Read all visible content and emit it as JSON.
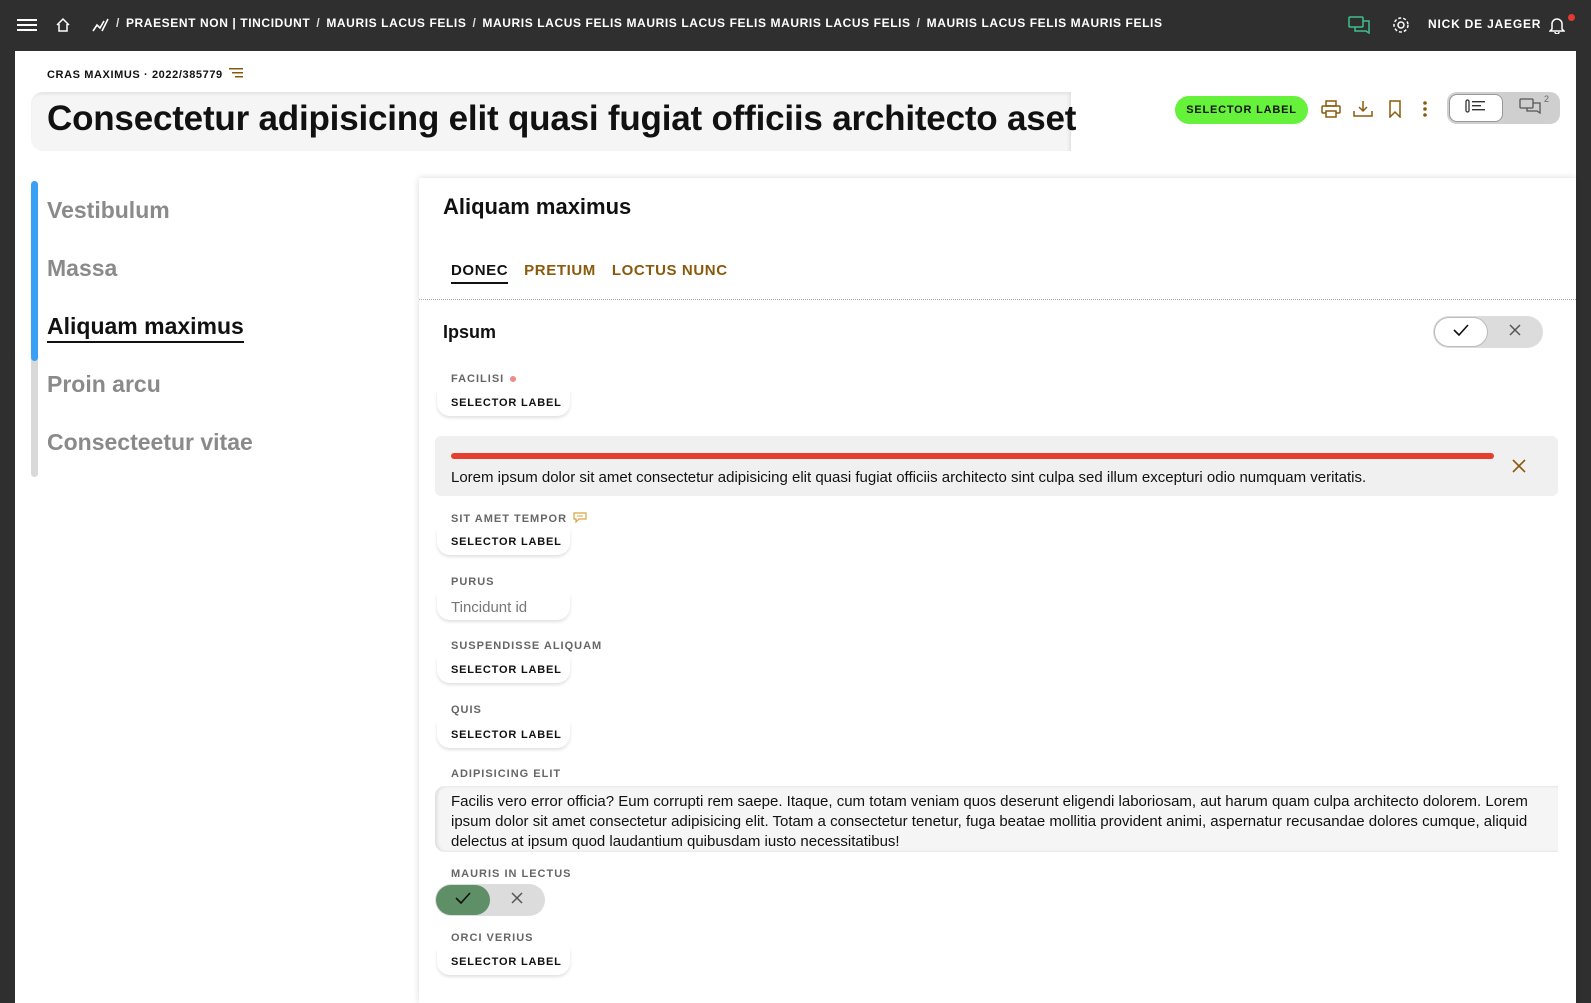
{
  "topbar": {
    "breadcrumb": [
      "PRAESENT NON | TINCIDUNT",
      "MAURIS LACUS FELIS",
      "MAURIS LACUS FELIS MAURIS LACUS FELIS MAURIS LACUS FELIS",
      "MAURIS LACUS FELIS MAURIS FELIS"
    ],
    "separator": "/",
    "user_name": "NICK DE JAEGER",
    "chat_icon_color": "#3fbf8f",
    "notification_dot_color": "#e53935"
  },
  "header": {
    "meta": "CRAS MAXIMUS · 2022/385779",
    "title": "Consectetur adipisicing elit quasi fugiat officiis architecto aset",
    "status_label": "SELECTOR LABEL",
    "status_color": "#66f23b",
    "action_icons": [
      "print-icon",
      "download-icon",
      "bookmark-icon",
      "more-vertical-icon"
    ],
    "accent_color": "#8a5a0c",
    "comment_count": "2"
  },
  "sidenav": {
    "items": [
      "Vestibulum",
      "Massa",
      "Aliquam maximus",
      "Proin arcu",
      "Consecteetur vitae"
    ],
    "active_index": 2,
    "progress_color": "#3aa0f3"
  },
  "card": {
    "title": "Aliquam maximus",
    "tabs": [
      "DONEC",
      "PRETIUM",
      "LOCTUS NUNC"
    ],
    "active_tab": "DONEC",
    "section_title": "Ipsum",
    "fields": {
      "facilisi": {
        "label": "FACILISI",
        "value": "SELECTOR LABEL"
      },
      "sit_amet_tempor": {
        "label": "SIT AMET TEMPOR",
        "value": "SELECTOR LABEL"
      },
      "purus": {
        "label": "PURUS",
        "value": "Tincidunt id"
      },
      "suspendisse_aliquam": {
        "label": "SUSPENDISSE ALIQUAM",
        "value": "SELECTOR LABEL"
      },
      "quis": {
        "label": "QUIS",
        "value": "SELECTOR LABEL"
      },
      "adipisicing_elit": {
        "label": "ADIPISICING ELIT",
        "value": "Facilis vero error officia? Eum corrupti rem saepe. Itaque, cum totam veniam quos deserunt eligendi laboriosam, aut harum quam culpa architecto dolorem. Lorem ipsum dolor sit amet consectetur adipisicing elit. Totam a consectetur tenetur, fuga beatae mollitia provident animi, aspernatur recusandae dolores cumque, aliquid delectus at ipsum quod laudantium quibusdam iusto necessitatibus!"
      },
      "mauris_in_lectus": {
        "label": "MAURIS IN LECTUS",
        "value": "yes"
      },
      "orci_verius": {
        "label": "ORCI VERIUS",
        "value": "SELECTOR LABEL"
      }
    },
    "alert": {
      "text": "Lorem ipsum dolor sit amet consectetur adipisicing elit quasi fugiat officiis architecto sint culpa sed illum excepturi odio numquam veritatis.",
      "color": "#e53f30"
    },
    "toggle_on_color": "#5f8f67"
  }
}
